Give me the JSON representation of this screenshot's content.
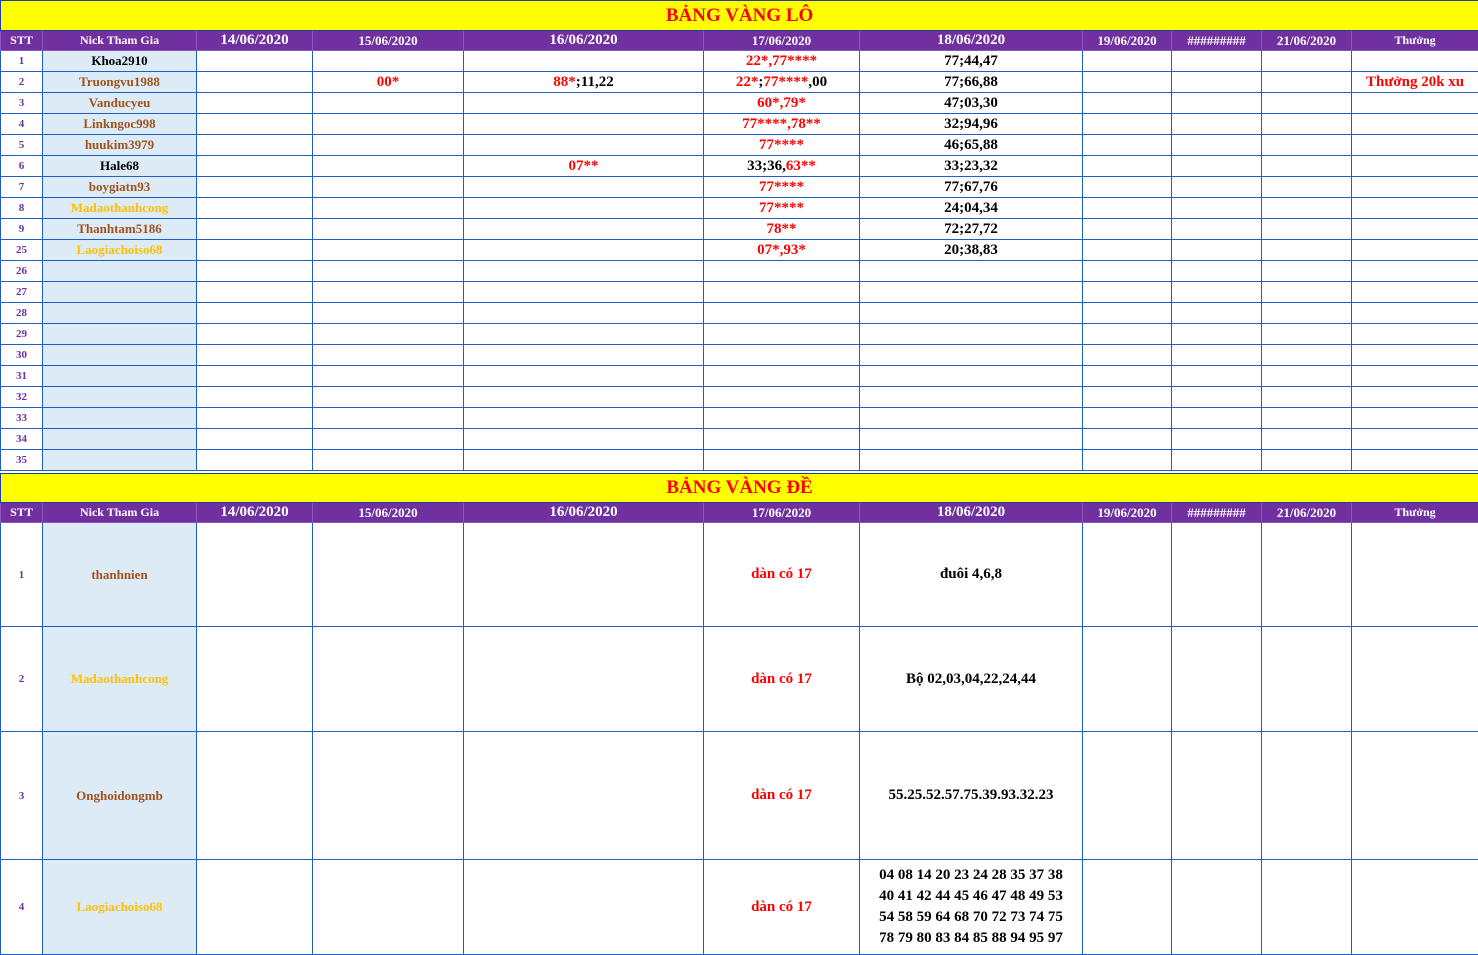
{
  "lo": {
    "title": "BẢNG VÀNG LÔ",
    "headers": [
      "STT",
      "Nick Tham Gia",
      "14/06/2020",
      "15/06/2020",
      "16/06/2020",
      "17/06/2020",
      "18/06/2020",
      "19/06/2020",
      "#########",
      "21/06/2020",
      "Thưởng"
    ],
    "rows": [
      {
        "stt": "1",
        "nick": "Khoa2910",
        "d15": "",
        "d16": "",
        "d17": "22*,77****",
        "d18": "77;44,47",
        "reward": ""
      },
      {
        "stt": "2",
        "nick": "Truongvu1988",
        "d15": "00*",
        "d16": "88*;11,22",
        "d17": "22*;77****,00",
        "d18": "77;66,88",
        "reward": "Thưởng 20k xu"
      },
      {
        "stt": "3",
        "nick": "Vanducyeu",
        "d15": "",
        "d16": "",
        "d17": "60*,79*",
        "d18": "47;03,30",
        "reward": ""
      },
      {
        "stt": "4",
        "nick": "Linkngoc998",
        "d15": "",
        "d16": "",
        "d17": "77****,78**",
        "d18": "32;94,96",
        "reward": ""
      },
      {
        "stt": "5",
        "nick": "huukim3979",
        "d15": "",
        "d16": "",
        "d17": "77****",
        "d18": "46;65,88",
        "reward": ""
      },
      {
        "stt": "6",
        "nick": "Hale68",
        "d15": "",
        "d16": "07**",
        "d17": "33;36,63**",
        "d18": "33;23,32",
        "reward": ""
      },
      {
        "stt": "7",
        "nick": "boygiatn93",
        "d15": "",
        "d16": "",
        "d17": "77****",
        "d18": "77;67,76",
        "reward": ""
      },
      {
        "stt": "8",
        "nick": "Madaothanhcong",
        "d15": "",
        "d16": "",
        "d17": "77****",
        "d18": "24;04,34",
        "reward": ""
      },
      {
        "stt": "9",
        "nick": "Thanhtam5186",
        "d15": "",
        "d16": "",
        "d17": "78**",
        "d18": "72;27,72",
        "reward": ""
      },
      {
        "stt": "25",
        "nick": "Laogiachoiso68",
        "d15": "",
        "d16": "",
        "d17": "07*,93*",
        "d18": "20;38,83",
        "reward": ""
      },
      {
        "stt": "26"
      },
      {
        "stt": "27"
      },
      {
        "stt": "28"
      },
      {
        "stt": "29"
      },
      {
        "stt": "30"
      },
      {
        "stt": "31"
      },
      {
        "stt": "32"
      },
      {
        "stt": "33"
      },
      {
        "stt": "34"
      },
      {
        "stt": "35"
      }
    ]
  },
  "de": {
    "title": "BẢNG VÀNG ĐỀ",
    "headers": [
      "STT",
      "Nick Tham Gia",
      "14/06/2020",
      "15/06/2020",
      "16/06/2020",
      "17/06/2020",
      "18/06/2020",
      "19/06/2020",
      "#########",
      "21/06/2020",
      "Thưởng"
    ],
    "rows": [
      {
        "stt": "1",
        "nick": "thanhnien",
        "d17": "dàn có 17",
        "d18": [
          "đuôi 4,6,8"
        ]
      },
      {
        "stt": "2",
        "nick": "Madaothanhcong",
        "d17": "dàn có 17",
        "d18": [
          "Bộ 02,03,04,22,24,44"
        ]
      },
      {
        "stt": "3",
        "nick": "Onghoidongmb",
        "d17": "dàn có 17",
        "d18": [
          "55.25.52.57.75.39.93.32.23"
        ]
      },
      {
        "stt": "4",
        "nick": "Laogiachoiso68",
        "d17": "dàn có 17",
        "d18": [
          "04 08 14 20 23 24 28 35 37 38",
          "40 41 42 44 45 46 47 48 49 53",
          "54 58 59 64 68 70 72 73 74 75",
          "78 79 80 83 84 85 88 94 95 97"
        ]
      }
    ]
  },
  "colors": {
    "title_bg": "#ffff00",
    "title_text": "#ff0000",
    "header_bg": "#7030a0",
    "nick_bg": "#ddebf7",
    "grid": "#1f5fbf"
  }
}
